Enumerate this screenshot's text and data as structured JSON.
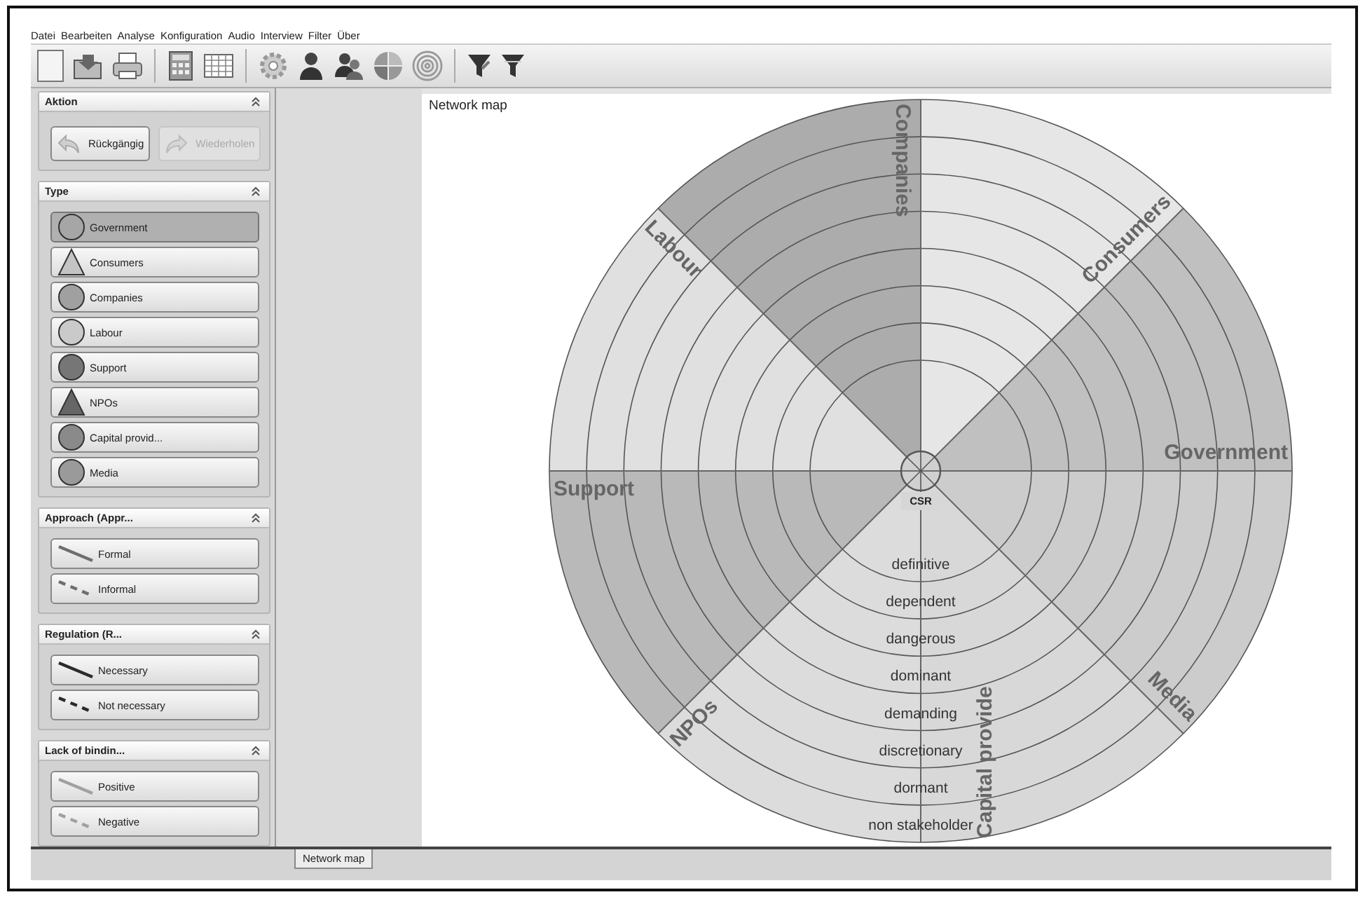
{
  "menu": [
    "Datei",
    "Bearbeiten",
    "Analyse",
    "Konfiguration",
    "Audio",
    "Interview",
    "Filter",
    "Über"
  ],
  "panels": [
    {
      "title": "Aktion",
      "kind": "actions",
      "buttons": [
        {
          "label": "Rückgängig",
          "disabled": false
        },
        {
          "label": "Wiederholen",
          "disabled": true
        }
      ]
    },
    {
      "title": "Type",
      "kind": "types",
      "items": [
        {
          "label": "Government",
          "kind": "circle",
          "color": "#a6a6a6",
          "selected": true
        },
        {
          "label": "Consumers",
          "kind": "triangle",
          "color": "#c4c4c4",
          "selected": false
        },
        {
          "label": "Companies",
          "kind": "circle",
          "color": "#a0a0a0",
          "selected": false
        },
        {
          "label": "Labour",
          "kind": "circle",
          "color": "#cacaca",
          "selected": false
        },
        {
          "label": "Support",
          "kind": "circle",
          "color": "#767676",
          "selected": false
        },
        {
          "label": "NPOs",
          "kind": "triangle",
          "color": "#666666",
          "selected": false
        },
        {
          "label": "Capital provid...",
          "kind": "circle",
          "color": "#8a8a8a",
          "selected": false
        },
        {
          "label": "Media",
          "kind": "circle",
          "color": "#9a9a9a",
          "selected": false
        }
      ]
    },
    {
      "title": "Approach (Appr...",
      "kind": "lines",
      "items": [
        {
          "label": "Formal",
          "dashed": false,
          "color": "#6e6e6e"
        },
        {
          "label": "Informal",
          "dashed": true,
          "color": "#6e6e6e"
        }
      ]
    },
    {
      "title": "Regulation  (R...",
      "kind": "lines",
      "items": [
        {
          "label": "Necessary",
          "dashed": false,
          "color": "#2a2a2a"
        },
        {
          "label": "Not necessary",
          "dashed": true,
          "color": "#2a2a2a"
        }
      ]
    },
    {
      "title": "Lack of bindin...",
      "kind": "lines",
      "items": [
        {
          "label": "Positive",
          "dashed": false,
          "color": "#a0a0a0"
        },
        {
          "label": "Negative",
          "dashed": true,
          "color": "#a0a0a0"
        }
      ]
    }
  ],
  "map": {
    "title": "Network map",
    "center": "CSR",
    "sectors": [
      {
        "label": "Government",
        "color": "#c0c0c0"
      },
      {
        "label": "Consumers",
        "color": "#e6e6e6"
      },
      {
        "label": "Companies",
        "color": "#acacac"
      },
      {
        "label": "Labour",
        "color": "#e0e0e0"
      },
      {
        "label": "Support",
        "color": "#b9b9b9"
      },
      {
        "label": "NPOs",
        "color": "#dcdcdc"
      },
      {
        "label": "Capital provide",
        "color": "#d8d8d8"
      },
      {
        "label": "Media",
        "color": "#cccccc"
      }
    ],
    "rings": [
      "definitive",
      "dependent",
      "dangerous",
      "dominant",
      "demanding",
      "discretionary",
      "dormant",
      "non stakeholder"
    ]
  },
  "tabs": [
    {
      "label": "Network map",
      "selected": true
    }
  ]
}
